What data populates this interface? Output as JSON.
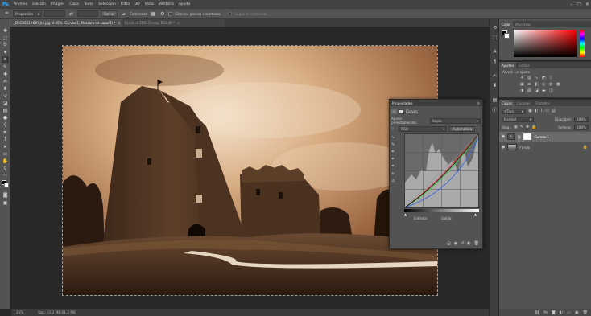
{
  "app": {
    "logo": "Ps"
  },
  "menu": [
    "Archivo",
    "Edición",
    "Imagen",
    "Capa",
    "Texto",
    "Selección",
    "Filtro",
    "3D",
    "Vista",
    "Ventana",
    "Ayuda"
  ],
  "window_controls": [
    "minimize-icon",
    "maximize-icon",
    "close-icon"
  ],
  "options_bar": {
    "aspect_select": "Proporción",
    "clear_button": "Borrar",
    "straighten_label": "Enderezar",
    "delete_cropped_label": "Eliminar píxeles recortados",
    "content_aware_label": "Según el contenido"
  },
  "tabs": [
    {
      "label": "_DSC8031-HDR_bn.jpg al 25% (Curvas 1, Máscara de capa/8) *",
      "close": "×"
    },
    {
      "label": "Fondo al 25% (Fondo, RGB/8) *",
      "close": "×"
    }
  ],
  "status": {
    "zoom": "25%",
    "doc": "Doc: 41,2 MB/41,2 MB"
  },
  "color_panel": {
    "tabs": [
      "Color",
      "Muestras"
    ]
  },
  "adjust_panel": {
    "tabs": [
      "Ajustes",
      "Estilos"
    ],
    "title": "Añadir un ajuste"
  },
  "layers_panel": {
    "tabs": [
      "Capas",
      "Canales",
      "Trazados"
    ],
    "filter": "Tipo",
    "blend_mode": "Normal",
    "opacity_label": "Opacidad:",
    "opacity_value": "100%",
    "lock_label": "Bloq.:",
    "fill_label": "Relleno:",
    "fill_value": "100%",
    "layers": [
      {
        "name": "Curvas 1",
        "selected": true
      },
      {
        "name": "Fondo",
        "selected": false
      }
    ]
  },
  "properties": {
    "title": "Propiedades",
    "header": "Curvas",
    "preset_label": "Ajuste preestablecido:",
    "preset_value": "Sepia",
    "channel": "RGB",
    "auto_button": "Automático",
    "input_label": "Entrada:",
    "output_label": "Salida:"
  },
  "colors": {
    "accent": "#31a8ff",
    "panel_bg": "#535353",
    "app_bg": "#282828",
    "fg_swatch": "#000000",
    "bg_swatch": "#ffffff"
  }
}
